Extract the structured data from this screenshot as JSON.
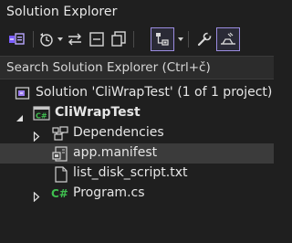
{
  "panel": {
    "title": "Solution Explorer"
  },
  "toolbar": {
    "buttons": [
      {
        "name": "switch-views-icon"
      },
      {
        "name": "history-icon"
      },
      {
        "name": "sync-icon"
      },
      {
        "name": "collapse-all-icon"
      },
      {
        "name": "copy-icon"
      },
      {
        "name": "filter-tree-icon"
      },
      {
        "name": "properties-wrench-icon"
      },
      {
        "name": "preview-icon"
      }
    ]
  },
  "search": {
    "placeholder": "Search Solution Explorer (Ctrl+č)"
  },
  "tree": {
    "solution": "Solution 'CliWrapTest' (1 of 1 project)",
    "project": "CliWrapTest",
    "items": [
      {
        "label": "Dependencies"
      },
      {
        "label": "app.manifest"
      },
      {
        "label": "list_disk_script.txt"
      },
      {
        "label": "Program.cs"
      }
    ]
  },
  "colors": {
    "background": "#1f1f1f",
    "accent": "#9b8ce0",
    "selected_row": "#3b3b3b",
    "csharp_green": "#3fbf4f"
  }
}
